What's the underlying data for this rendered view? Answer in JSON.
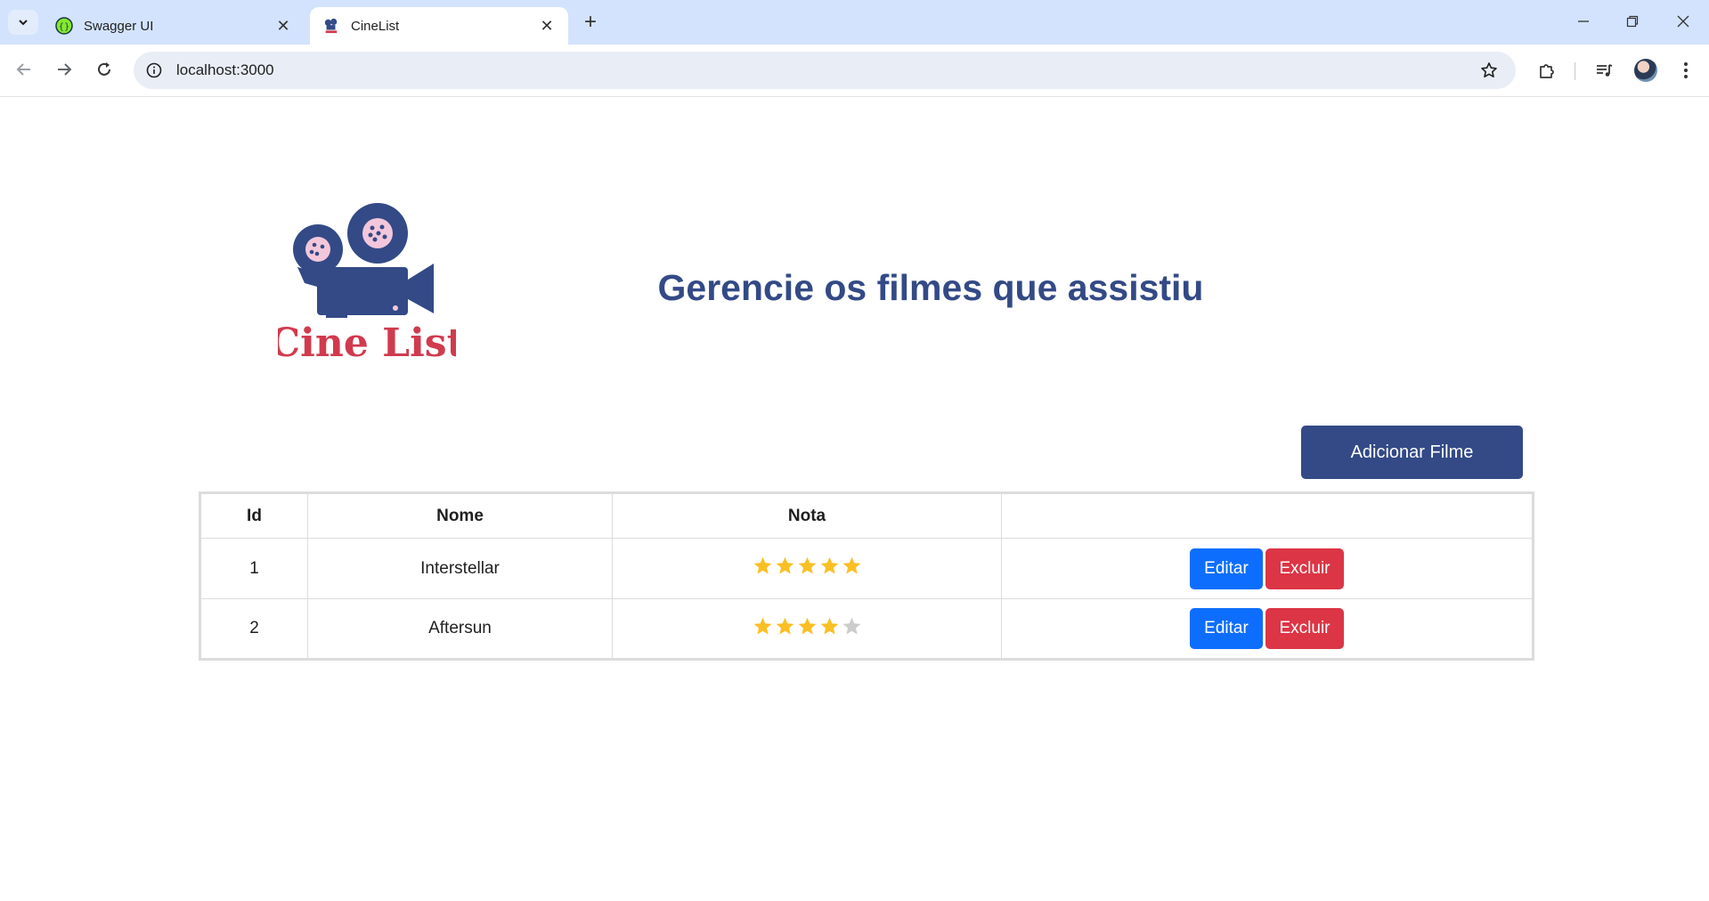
{
  "browser": {
    "tabs": [
      {
        "title": "Swagger UI",
        "favicon": "swagger-icon",
        "active": false
      },
      {
        "title": "CineList",
        "favicon": "cinelist-icon",
        "active": true
      }
    ],
    "url": "localhost:3000"
  },
  "header": {
    "logo_text": "Cine List",
    "headline": "Gerencie os filmes que assistiu"
  },
  "actions": {
    "add_label": "Adicionar Filme"
  },
  "table": {
    "headers": [
      "Id",
      "Nome",
      "Nota",
      ""
    ],
    "rows": [
      {
        "id": "1",
        "nome": "Interstellar",
        "nota": 5,
        "edit_label": "Editar",
        "delete_label": "Excluir"
      },
      {
        "id": "2",
        "nome": "Aftersun",
        "nota": 4,
        "edit_label": "Editar",
        "delete_label": "Excluir"
      }
    ],
    "max_rating": 5
  },
  "colors": {
    "brand_blue": "#334a86",
    "brand_red": "#d13a4e",
    "star_filled": "#fbbf24",
    "star_empty": "#cccccc",
    "edit": "#0d6efd",
    "delete": "#dc3545"
  }
}
